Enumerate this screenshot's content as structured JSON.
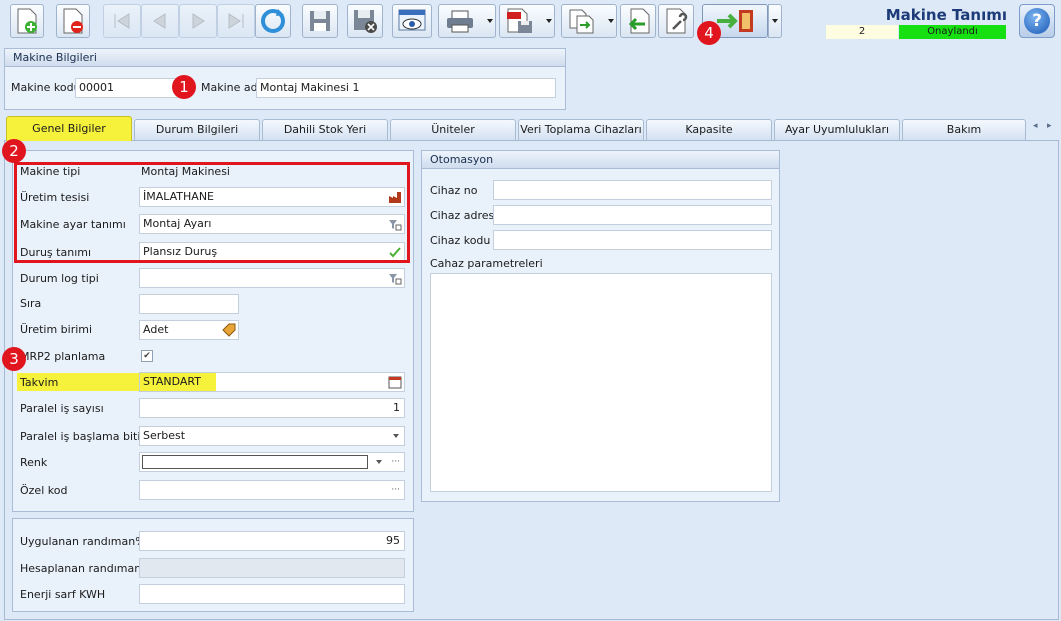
{
  "toolbar": {
    "icons": [
      "new-document-icon",
      "delete-document-icon",
      "first-record-icon",
      "previous-record-icon",
      "next-record-icon",
      "last-record-icon",
      "refresh-icon",
      "save-icon",
      "save-close-icon",
      "preview-icon",
      "print-icon",
      "pdf-export-icon",
      "copy-icon",
      "back-icon",
      "settings-icon",
      "exit-icon"
    ]
  },
  "header": {
    "title": "Makine Tanımı",
    "record_no": "2",
    "status": "Onaylandı",
    "status_color": "#17e012"
  },
  "machine_info": {
    "group_title": "Makine Bilgileri",
    "code_label": "Makine kodu",
    "code_value": "00001",
    "name_label": "Makine adı",
    "name_value": "Montaj Makinesi 1"
  },
  "tabs": [
    "Genel Bilgiler",
    "Durum Bilgileri",
    "Dahili Stok Yeri",
    "Üniteler",
    "Veri Toplama Cihazları",
    "Kapasite",
    "Ayar Uyumlulukları",
    "Bakım"
  ],
  "general": {
    "fields": [
      {
        "label": "Makine tipi",
        "value": "Montaj Makinesi"
      },
      {
        "label": "Üretim tesisi",
        "value": "İMALATHANE"
      },
      {
        "label": "Makine ayar tanımı",
        "value": "Montaj Ayarı"
      },
      {
        "label": "Duruş tanımı",
        "value": "Plansız Duruş"
      },
      {
        "label": "Durum log tipi",
        "value": ""
      },
      {
        "label": "Sıra",
        "value": ""
      },
      {
        "label": "Üretim birimi",
        "value": "Adet"
      },
      {
        "label": "MRP2 planlama",
        "value": "✔"
      },
      {
        "label": "Takvim",
        "value": "STANDART"
      },
      {
        "label": "Paralel iş sayısı",
        "value": "1"
      },
      {
        "label": "Paralel iş başlama bitiş",
        "value": "Serbest"
      },
      {
        "label": "Renk",
        "value": ""
      },
      {
        "label": "Özel kod",
        "value": ""
      }
    ]
  },
  "efficiency": {
    "applied_label": "Uygulanan randıman%",
    "applied_value": "95",
    "calculated_label": "Hesaplanan randıman%",
    "calculated_value": "",
    "energy_label": "Enerji sarf KWH",
    "energy_value": ""
  },
  "automation": {
    "group_title": "Otomasyon",
    "device_no_label": "Cihaz no",
    "device_address_label": "Cihaz adresi",
    "device_code_label": "Cihaz kodu",
    "params_label": "Cahaz parametreleri"
  },
  "annotations": [
    "1",
    "2",
    "3",
    "4"
  ],
  "ellipsis": "···"
}
